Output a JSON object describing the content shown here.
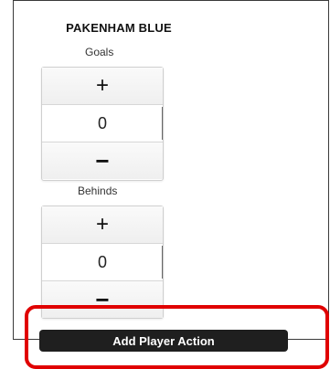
{
  "team": {
    "name": "PAKENHAM BLUE"
  },
  "goals": {
    "label": "Goals",
    "value": "0",
    "plus": "+",
    "minus": "−"
  },
  "behinds": {
    "label": "Behinds",
    "value": "0",
    "plus": "+",
    "minus": "−"
  },
  "actions": {
    "add_player_action": "Add Player Action"
  },
  "colors": {
    "highlight": "#e00000",
    "button_bg": "#1f1f1f"
  }
}
